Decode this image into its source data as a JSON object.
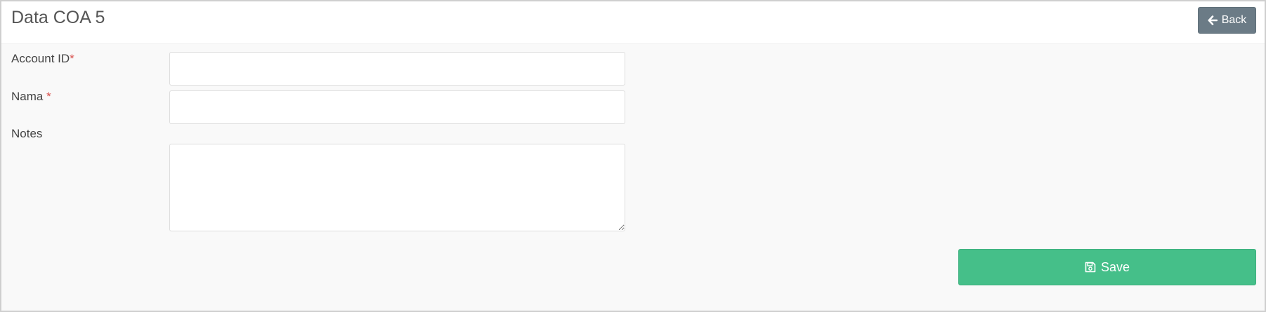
{
  "header": {
    "title": "Data COA 5",
    "back_label": "Back",
    "back_icon": "arrow-left-icon"
  },
  "form": {
    "account_id": {
      "label": "Account ID",
      "required_mark": "*",
      "value": "",
      "placeholder": ""
    },
    "nama": {
      "label": "Nama ",
      "required_mark": "*",
      "value": "",
      "placeholder": ""
    },
    "notes": {
      "label": "Notes",
      "value": "",
      "placeholder": ""
    }
  },
  "actions": {
    "save_label": "Save",
    "save_icon": "floppy-disk-icon"
  },
  "colors": {
    "back_button": "#6b7b86",
    "save_button": "#45bf89",
    "required": "#d9534f"
  }
}
